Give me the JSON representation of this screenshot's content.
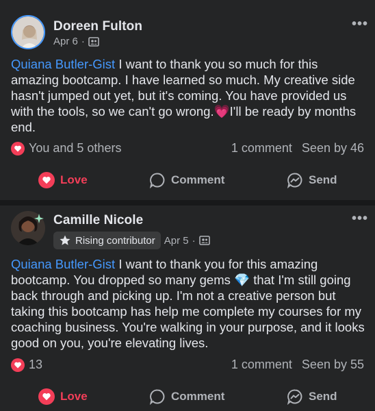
{
  "posts": [
    {
      "author": "Doreen Fulton",
      "date": "Apr 6",
      "mention": "Quiana Butler-Gist",
      "text_a": " I want to thank you so much for this amazing bootcamp.  I have learned so much.  My creative side hasn't jumped out yet, but it's coming.  You have provided us with the tools, so we can't go wrong.",
      "emoji": "💗",
      "text_b": "I'll be ready by months end.",
      "reactions": "You and 5 others",
      "comments": "1 comment",
      "seen": "Seen by 46"
    },
    {
      "author": "Camille Nicole",
      "badge": "Rising contributor",
      "date": "Apr 5",
      "mention": "Quiana Butler-Gist",
      "text_a": " I want to thank you for this amazing bootcamp. You dropped so many gems ",
      "emoji": "💎",
      "text_b": " that I'm still going back through and picking up. I'm not a creative person but taking this bootcamp has help me complete my courses for my coaching business. You're walking in your purpose, and it looks good on you, you're elevating lives.",
      "reactions": "13",
      "comments": "1 comment",
      "seen": "Seen by 55"
    }
  ],
  "actions": {
    "love": "Love",
    "comment": "Comment",
    "send": "Send"
  },
  "meta": {
    "separator": "·"
  },
  "colors": {
    "background": "#242526",
    "mention": "#4599ff",
    "love": "#f33e58",
    "muted": "#b0b3b8"
  },
  "icons": [
    "more-options-icon",
    "group-audience-icon",
    "heart-icon",
    "comment-icon",
    "messenger-send-icon",
    "star-icon"
  ]
}
